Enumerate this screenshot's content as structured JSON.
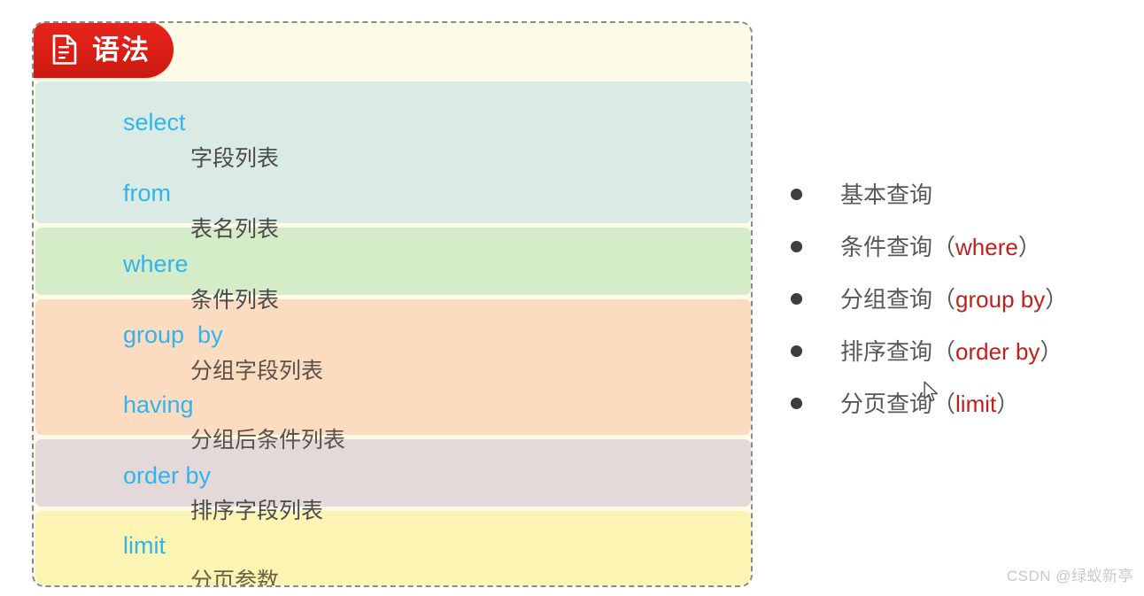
{
  "syntax_card": {
    "badge": {
      "icon": "document-icon",
      "label": "语法"
    },
    "bands": [
      {
        "name": "select-from",
        "color": "#daeae4"
      },
      {
        "name": "where",
        "color": "#d5ecc8"
      },
      {
        "name": "group-having",
        "color": "#fcdcc1"
      },
      {
        "name": "order-by",
        "color": "#e3d9d8"
      },
      {
        "name": "limit",
        "color": "#fbf4b2"
      }
    ],
    "lines": [
      {
        "keyword": "select",
        "description": "字段列表"
      },
      {
        "keyword": "from",
        "description": "表名列表"
      },
      {
        "keyword": "where",
        "description": "条件列表"
      },
      {
        "keyword": "group  by",
        "description": "分组字段列表"
      },
      {
        "keyword": "having",
        "description": "分组后条件列表"
      },
      {
        "keyword": "order by",
        "description": "排序字段列表"
      },
      {
        "keyword": "limit",
        "description": "分页参数"
      }
    ],
    "keyword_color": "#31b4ee",
    "border_style": "dashed"
  },
  "feature_list": {
    "items": [
      {
        "label": "基本查询",
        "keyword": "",
        "open_paren": "",
        "close_paren": ""
      },
      {
        "label": "条件查询",
        "keyword": "where",
        "open_paren": "（",
        "close_paren": "）"
      },
      {
        "label": "分组查询",
        "keyword": "group by",
        "open_paren": "（",
        "close_paren": "）"
      },
      {
        "label": "排序查询",
        "keyword": "order by",
        "open_paren": "（",
        "close_paren": "）"
      },
      {
        "label": "分页查询",
        "keyword": "limit",
        "open_paren": "（",
        "close_paren": "）"
      }
    ],
    "keyword_color": "#c0201b",
    "bullet_color": "#3d3d3d"
  },
  "watermark": {
    "text": "CSDN @绿蚁新亭"
  }
}
